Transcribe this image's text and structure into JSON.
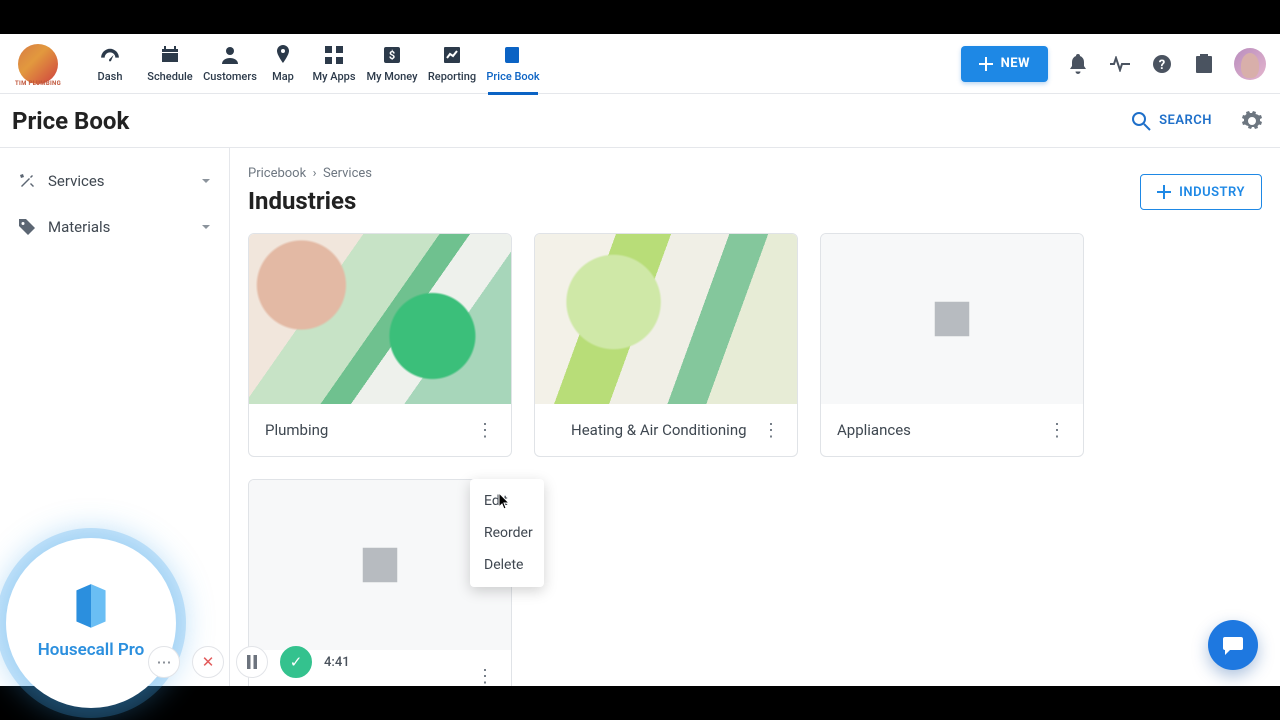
{
  "brand": {
    "name": "TIM PLUMBING"
  },
  "nav": [
    {
      "label": "Dash"
    },
    {
      "label": "Schedule"
    },
    {
      "label": "Customers"
    },
    {
      "label": "Map"
    },
    {
      "label": "My Apps"
    },
    {
      "label": "My Money"
    },
    {
      "label": "Reporting"
    },
    {
      "label": "Price Book"
    }
  ],
  "new_button_label": "NEW",
  "page_title": "Price Book",
  "search_label": "SEARCH",
  "sidebar": {
    "items": [
      {
        "label": "Services"
      },
      {
        "label": "Materials"
      }
    ]
  },
  "breadcrumb": {
    "a": "Pricebook",
    "b": "Services"
  },
  "heading": "Industries",
  "industry_button_label": "INDUSTRY",
  "cards": [
    {
      "title": "Plumbing",
      "has_image": true
    },
    {
      "title": "Heating & Air Conditioning",
      "has_image": true
    },
    {
      "title": "Appliances",
      "has_image": false
    },
    {
      "title": "",
      "has_image": false
    }
  ],
  "menu": {
    "items": [
      "Edit",
      "Reorder",
      "Delete"
    ]
  },
  "badge_text": "Housecall Pro",
  "recorder": {
    "time": "4:41"
  }
}
